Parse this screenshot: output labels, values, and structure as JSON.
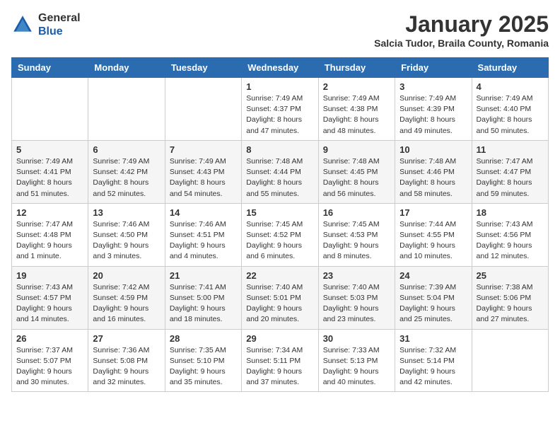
{
  "logo": {
    "general": "General",
    "blue": "Blue"
  },
  "title": "January 2025",
  "subtitle": "Salcia Tudor, Braila County, Romania",
  "weekdays": [
    "Sunday",
    "Monday",
    "Tuesday",
    "Wednesday",
    "Thursday",
    "Friday",
    "Saturday"
  ],
  "weeks": [
    [
      {
        "day": "",
        "info": ""
      },
      {
        "day": "",
        "info": ""
      },
      {
        "day": "",
        "info": ""
      },
      {
        "day": "1",
        "info": "Sunrise: 7:49 AM\nSunset: 4:37 PM\nDaylight: 8 hours\nand 47 minutes."
      },
      {
        "day": "2",
        "info": "Sunrise: 7:49 AM\nSunset: 4:38 PM\nDaylight: 8 hours\nand 48 minutes."
      },
      {
        "day": "3",
        "info": "Sunrise: 7:49 AM\nSunset: 4:39 PM\nDaylight: 8 hours\nand 49 minutes."
      },
      {
        "day": "4",
        "info": "Sunrise: 7:49 AM\nSunset: 4:40 PM\nDaylight: 8 hours\nand 50 minutes."
      }
    ],
    [
      {
        "day": "5",
        "info": "Sunrise: 7:49 AM\nSunset: 4:41 PM\nDaylight: 8 hours\nand 51 minutes."
      },
      {
        "day": "6",
        "info": "Sunrise: 7:49 AM\nSunset: 4:42 PM\nDaylight: 8 hours\nand 52 minutes."
      },
      {
        "day": "7",
        "info": "Sunrise: 7:49 AM\nSunset: 4:43 PM\nDaylight: 8 hours\nand 54 minutes."
      },
      {
        "day": "8",
        "info": "Sunrise: 7:48 AM\nSunset: 4:44 PM\nDaylight: 8 hours\nand 55 minutes."
      },
      {
        "day": "9",
        "info": "Sunrise: 7:48 AM\nSunset: 4:45 PM\nDaylight: 8 hours\nand 56 minutes."
      },
      {
        "day": "10",
        "info": "Sunrise: 7:48 AM\nSunset: 4:46 PM\nDaylight: 8 hours\nand 58 minutes."
      },
      {
        "day": "11",
        "info": "Sunrise: 7:47 AM\nSunset: 4:47 PM\nDaylight: 8 hours\nand 59 minutes."
      }
    ],
    [
      {
        "day": "12",
        "info": "Sunrise: 7:47 AM\nSunset: 4:48 PM\nDaylight: 9 hours\nand 1 minute."
      },
      {
        "day": "13",
        "info": "Sunrise: 7:46 AM\nSunset: 4:50 PM\nDaylight: 9 hours\nand 3 minutes."
      },
      {
        "day": "14",
        "info": "Sunrise: 7:46 AM\nSunset: 4:51 PM\nDaylight: 9 hours\nand 4 minutes."
      },
      {
        "day": "15",
        "info": "Sunrise: 7:45 AM\nSunset: 4:52 PM\nDaylight: 9 hours\nand 6 minutes."
      },
      {
        "day": "16",
        "info": "Sunrise: 7:45 AM\nSunset: 4:53 PM\nDaylight: 9 hours\nand 8 minutes."
      },
      {
        "day": "17",
        "info": "Sunrise: 7:44 AM\nSunset: 4:55 PM\nDaylight: 9 hours\nand 10 minutes."
      },
      {
        "day": "18",
        "info": "Sunrise: 7:43 AM\nSunset: 4:56 PM\nDaylight: 9 hours\nand 12 minutes."
      }
    ],
    [
      {
        "day": "19",
        "info": "Sunrise: 7:43 AM\nSunset: 4:57 PM\nDaylight: 9 hours\nand 14 minutes."
      },
      {
        "day": "20",
        "info": "Sunrise: 7:42 AM\nSunset: 4:59 PM\nDaylight: 9 hours\nand 16 minutes."
      },
      {
        "day": "21",
        "info": "Sunrise: 7:41 AM\nSunset: 5:00 PM\nDaylight: 9 hours\nand 18 minutes."
      },
      {
        "day": "22",
        "info": "Sunrise: 7:40 AM\nSunset: 5:01 PM\nDaylight: 9 hours\nand 20 minutes."
      },
      {
        "day": "23",
        "info": "Sunrise: 7:40 AM\nSunset: 5:03 PM\nDaylight: 9 hours\nand 23 minutes."
      },
      {
        "day": "24",
        "info": "Sunrise: 7:39 AM\nSunset: 5:04 PM\nDaylight: 9 hours\nand 25 minutes."
      },
      {
        "day": "25",
        "info": "Sunrise: 7:38 AM\nSunset: 5:06 PM\nDaylight: 9 hours\nand 27 minutes."
      }
    ],
    [
      {
        "day": "26",
        "info": "Sunrise: 7:37 AM\nSunset: 5:07 PM\nDaylight: 9 hours\nand 30 minutes."
      },
      {
        "day": "27",
        "info": "Sunrise: 7:36 AM\nSunset: 5:08 PM\nDaylight: 9 hours\nand 32 minutes."
      },
      {
        "day": "28",
        "info": "Sunrise: 7:35 AM\nSunset: 5:10 PM\nDaylight: 9 hours\nand 35 minutes."
      },
      {
        "day": "29",
        "info": "Sunrise: 7:34 AM\nSunset: 5:11 PM\nDaylight: 9 hours\nand 37 minutes."
      },
      {
        "day": "30",
        "info": "Sunrise: 7:33 AM\nSunset: 5:13 PM\nDaylight: 9 hours\nand 40 minutes."
      },
      {
        "day": "31",
        "info": "Sunrise: 7:32 AM\nSunset: 5:14 PM\nDaylight: 9 hours\nand 42 minutes."
      },
      {
        "day": "",
        "info": ""
      }
    ]
  ]
}
